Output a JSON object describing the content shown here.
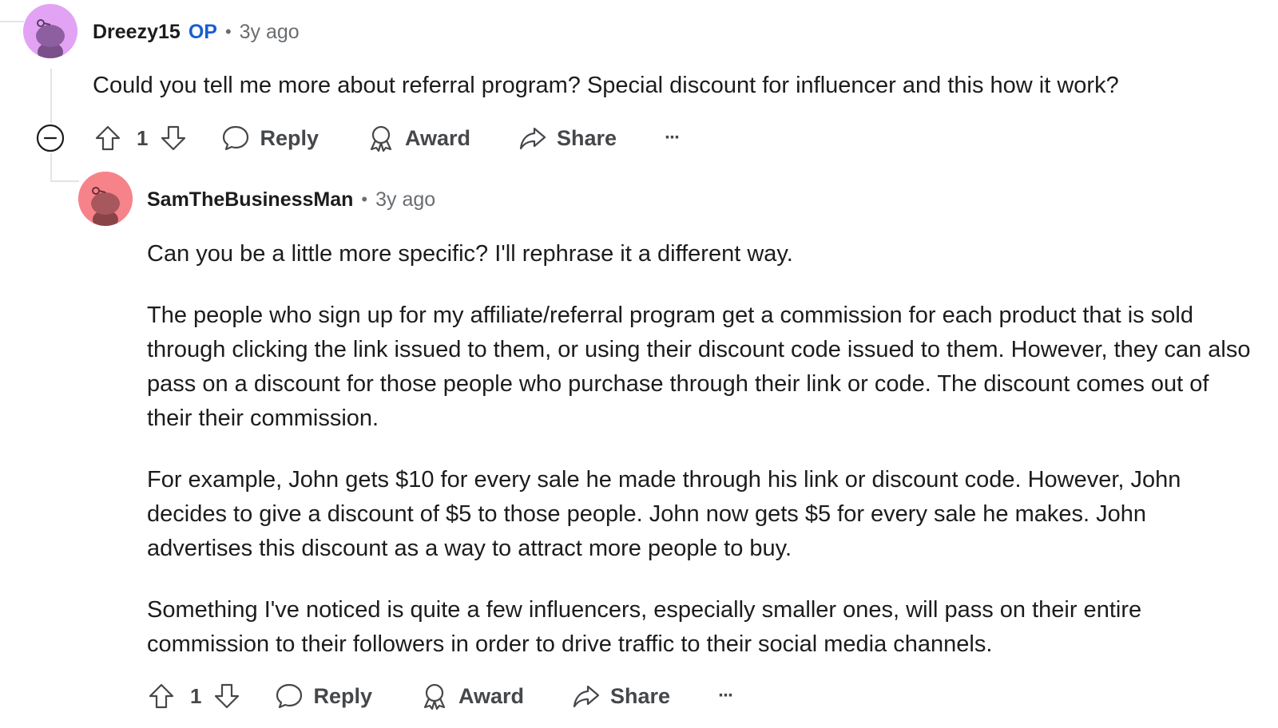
{
  "comments": [
    {
      "author": "Dreezy15",
      "op_badge": "OP",
      "separator": "•",
      "time": "3y ago",
      "avatar_color": "#e3a3f5",
      "paragraphs": [
        "Could you tell me more about referral program? Special discount for influencer and this how it work?"
      ],
      "votes": "1",
      "actions": {
        "reply": "Reply",
        "award": "Award",
        "share": "Share",
        "more": "···"
      }
    },
    {
      "author": "SamTheBusinessMan",
      "separator": "•",
      "time": "3y ago",
      "avatar_color": "#f7838a",
      "paragraphs": [
        "Can you be a little more specific? I'll rephrase it a different way.",
        "The people who sign up for my affiliate/referral program get a commission for each product that is sold through clicking the link issued to them, or using their discount code issued to them. However, they can also pass on a discount for those people who purchase through their link or code. The discount comes out of their their commission.",
        "For example, John gets $10 for every sale he made through his link or discount code. However, John decides to give a discount of $5 to those people. John now gets $5 for every sale he makes. John advertises this discount as a way to attract more people to buy.",
        "Something I've noticed is quite a few influencers, especially smaller ones, will pass on their entire commission to their followers in order to drive traffic to their social media channels."
      ],
      "votes": "1",
      "actions": {
        "reply": "Reply",
        "award": "Award",
        "share": "Share",
        "more": "···"
      }
    }
  ],
  "colors": {
    "text": "#1c1c1c",
    "meta": "#6a6d70",
    "op": "#1a5cd0",
    "thread": "#e2e4e6"
  }
}
